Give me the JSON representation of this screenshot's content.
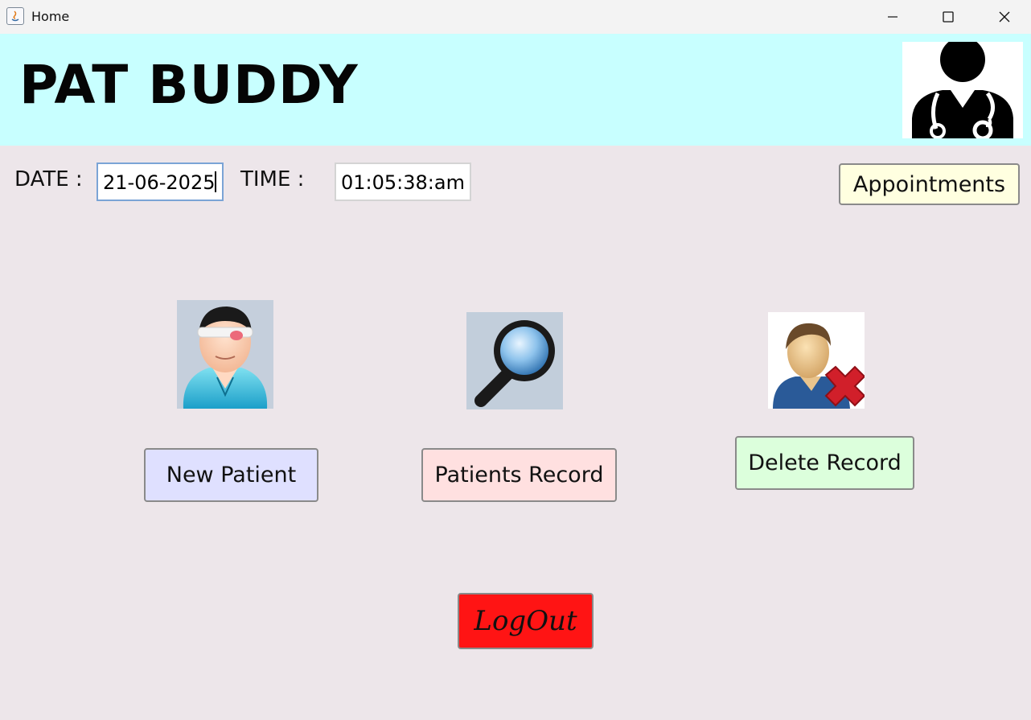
{
  "window": {
    "title": "Home",
    "icons": {
      "app": "java-app-icon",
      "minimize": "minimize-icon",
      "maximize": "maximize-icon",
      "close": "close-icon"
    }
  },
  "header": {
    "app_title": "PAT BUDDY",
    "logo_icon": "doctor-icon"
  },
  "datetime": {
    "date_label": "DATE :",
    "date_value": "21-06-2025",
    "time_label": "TIME :",
    "time_value": "01:05:38:am"
  },
  "actions": {
    "appointments_label": "Appointments",
    "new_patient_label": "New Patient",
    "patients_record_label": "Patients Record",
    "delete_record_label": "Delete Record",
    "logout_label": "LogOut"
  },
  "colors": {
    "header_bg": "#c8ffff",
    "body_bg": "#ede6ea",
    "appointments_bg": "#ffffe0",
    "new_patient_bg": "#dfe0ff",
    "patients_record_bg": "#ffe0e0",
    "delete_record_bg": "#dcffdc",
    "logout_bg": "#ff1414"
  }
}
